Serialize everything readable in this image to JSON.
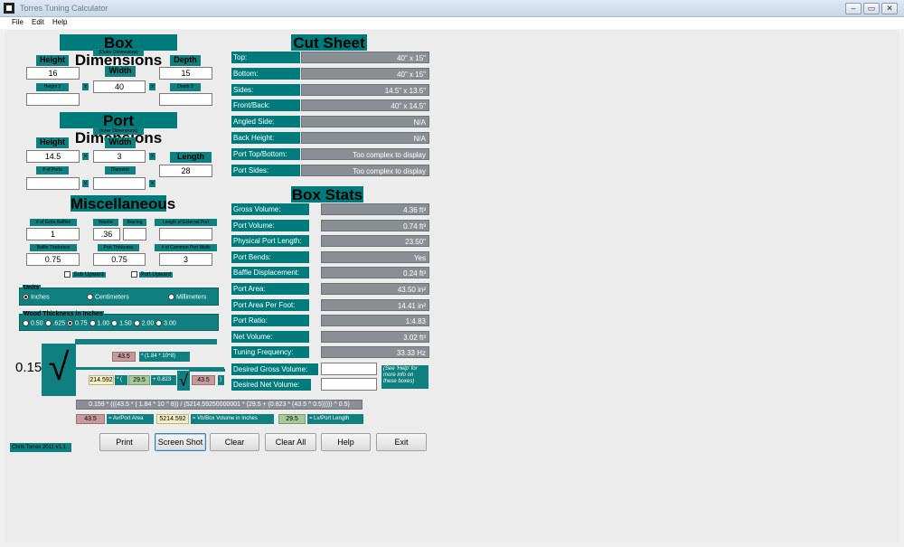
{
  "window": {
    "title": "Torres Tuning Calculator",
    "min": "–",
    "max": "▭",
    "close": "✕"
  },
  "menu": [
    "File",
    "Edit",
    "Help"
  ],
  "box": {
    "title": "Box Dimensions",
    "subtitle": "(Outer Dimensions)",
    "height_label": "Height",
    "width_label": "Width",
    "depth_label": "Depth",
    "height": "16",
    "width": "40",
    "depth": "15",
    "height2_label": "Height 2",
    "depth2_label": "Depth 2",
    "height2": "",
    "depth2": "",
    "x": "x"
  },
  "port": {
    "title": "Port Dimensions",
    "subtitle": "(Inner Dimensions)",
    "height_label": "Height",
    "width_label": "Width",
    "length_label": "Length",
    "height": "14.5",
    "width": "3",
    "length": "28",
    "ports_label": "# of Ports",
    "diameter_label": "Diameter",
    "ports": "",
    "diameter": ""
  },
  "misc": {
    "title": "Miscellaneous",
    "baffles_label": "# of Extra Baffles",
    "woofer_label": "Woofer",
    "bracing_label": "Bracing",
    "ext_port_label": "Length of External Port",
    "baffles": "1",
    "woofer": ".36",
    "bracing": "",
    "ext_port": "",
    "baffle_thk_label": "Baffle Thickness",
    "port_thk_label": "Port Thickness",
    "common_walls_label": "# of Common Port Walls",
    "baffle_thk": "0.75",
    "port_thk": "0.75",
    "common_walls": "3",
    "sub_upward": "Sub Upward",
    "port_upward": "Port Upward"
  },
  "units": {
    "title": "Units",
    "options": [
      "Inches",
      "Centimeters",
      "Millimeters"
    ],
    "selected": "Inches"
  },
  "wood": {
    "title": "Wood Thickness in Inches",
    "options": [
      "0.50",
      ".625",
      "0.75",
      "1.00",
      "1.50",
      "2.00",
      "3.00"
    ],
    "selected": "0.75"
  },
  "formula": {
    "big_num": "0.15",
    "area1": "43.5",
    "const1": "* (1.84 * 10^8)",
    "vb": "214.592",
    "paren": "* (",
    "lv": "29.5",
    "plus": "+ 0.823",
    "area2": "43.5",
    "close": ")",
    "full": "0.159 * (((43.5 * ( 1.84 * 10 ^ 8)) / (5214.59250000001 * (29.5 + (0.823 * (43.5 ^ 0.5))))) ^ 0.5)",
    "legend_area": "43.5",
    "legend_area_label": "= Av/Port Area",
    "legend_vb": "5214.592",
    "legend_vb_label": "= Vb/Box Volume in Inches",
    "legend_lv": "29.5",
    "legend_lv_label": "= Lv/Port Length"
  },
  "cut": {
    "title": "Cut Sheet",
    "rows": [
      {
        "label": "Top:",
        "value": "40\" x 15\""
      },
      {
        "label": "Bottom:",
        "value": "40\" x 15\""
      },
      {
        "label": "Sides:",
        "value": "14.5\" x 13.5\""
      },
      {
        "label": "Front/Back:",
        "value": "40\" x 14.5\""
      },
      {
        "label": "Angled Side:",
        "value": "N/A"
      },
      {
        "label": "Back Height:",
        "value": "N/A"
      },
      {
        "label": "Port Top/Bottom:",
        "value": "Too complex to display"
      },
      {
        "label": "Port Sides:",
        "value": "Too complex to display"
      }
    ]
  },
  "stats": {
    "title": "Box Stats",
    "rows": [
      {
        "label": "Gross Volume:",
        "value": "4.36 ft³"
      },
      {
        "label": "Port Volume:",
        "value": "0.74 ft³"
      },
      {
        "label": "Physical Port Length:",
        "value": "23.50\""
      },
      {
        "label": "Port Bends:",
        "value": "Yes"
      },
      {
        "label": "Baffle Displacement:",
        "value": "0.24 ft³"
      },
      {
        "label": "Port Area:",
        "value": "43.50 in²"
      },
      {
        "label": "Port Area Per Foot:",
        "value": "14.41 in²"
      },
      {
        "label": "Port Ratio:",
        "value": "1:4.83"
      },
      {
        "label": "Net Volume:",
        "value": "3.02 ft³"
      },
      {
        "label": "Tuning Frequency:",
        "value": "33.33 Hz"
      }
    ],
    "desired_gross_label": "Desired Gross Volume:",
    "desired_net_label": "Desired Net Volume:",
    "help_note": "(See 'Help' for more info on these boxes)"
  },
  "buttons": [
    "Print",
    "Screen Shot",
    "Clear",
    "Clear All",
    "Help",
    "Exit"
  ],
  "footer": "Chris Torres 2011 v1.1"
}
